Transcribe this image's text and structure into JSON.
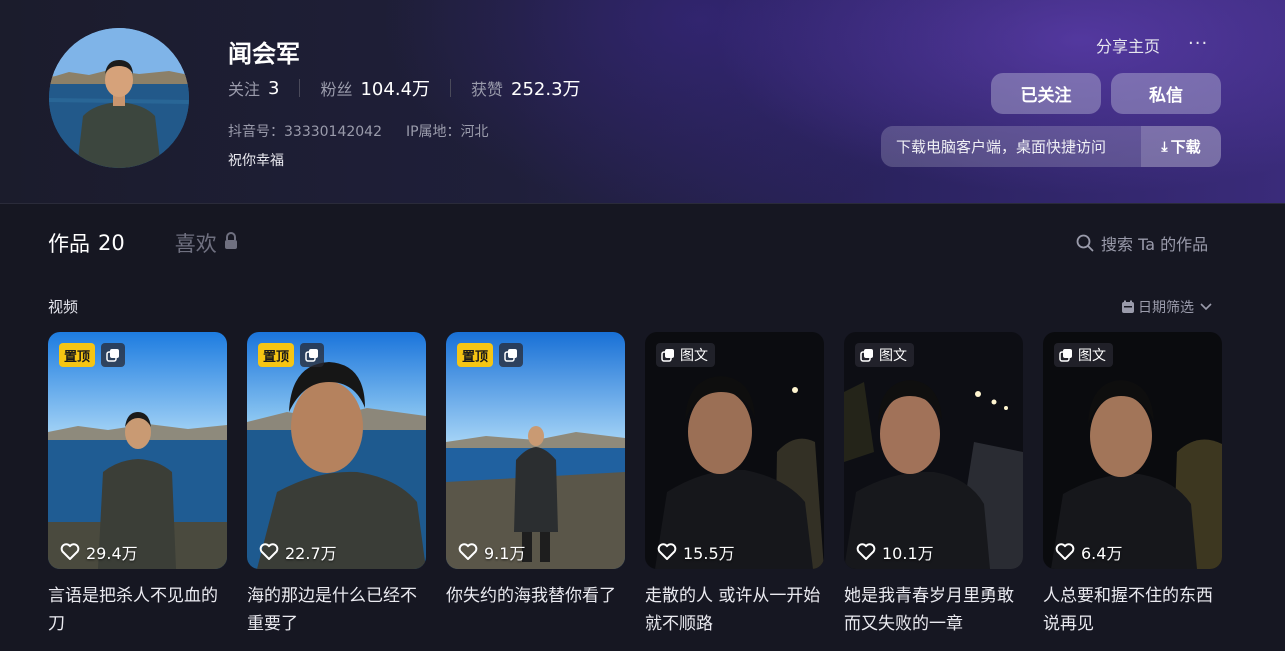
{
  "profile": {
    "name": "闻会军",
    "stats": [
      {
        "label": "关注",
        "value": "3"
      },
      {
        "label": "粉丝",
        "value": "104.4万"
      },
      {
        "label": "获赞",
        "value": "252.3万"
      }
    ],
    "douyin_id": "抖音号：33330142042",
    "ip_location": "IP属地：河北",
    "signature": "祝你幸福"
  },
  "top_actions": {
    "share": "分享主页",
    "more": "···",
    "follow": "已关注",
    "message": "私信",
    "download_text": "下载电脑客户端，桌面快捷访问",
    "download_btn": "下载"
  },
  "tabs": [
    {
      "label": "作品",
      "count": "20",
      "active": true
    },
    {
      "label": "喜欢",
      "count": "",
      "active": false,
      "locked": true
    }
  ],
  "search_placeholder": "搜索 Ta 的作品",
  "section": {
    "label": "视频",
    "filter": "日期筛选"
  },
  "videos": [
    {
      "caption": "言语是把杀人不见血的刀",
      "likes": "29.4万",
      "pinned": true,
      "pin_label": "置顶",
      "type": "video"
    },
    {
      "caption": "海的那边是什么已经不重要了",
      "likes": "22.7万",
      "pinned": true,
      "pin_label": "置顶",
      "type": "video"
    },
    {
      "caption": "你失约的海我替你看了",
      "likes": "9.1万",
      "pinned": true,
      "pin_label": "置顶",
      "type": "video"
    },
    {
      "caption": "走散的人 或许从一开始就不顺路",
      "likes": "15.5万",
      "pinned": false,
      "photo_label": "图文",
      "type": "photo"
    },
    {
      "caption": "她是我青春岁月里勇敢而又失败的一章",
      "likes": "10.1万",
      "pinned": false,
      "photo_label": "图文",
      "type": "photo"
    },
    {
      "caption": "人总要和握不住的东西说再见",
      "likes": "6.4万",
      "pinned": false,
      "photo_label": "图文",
      "type": "photo"
    }
  ],
  "colors": {
    "background": "#161722",
    "pin": "#f6c513",
    "muted": "#9a9bab"
  }
}
